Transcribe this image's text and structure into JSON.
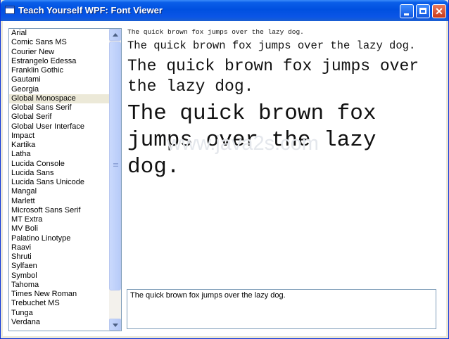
{
  "window": {
    "title": "Teach Yourself WPF: Font Viewer",
    "minimize_glyph": "",
    "maximize_glyph": "",
    "close_glyph": "✕"
  },
  "font_list": {
    "selected": "Global Monospace",
    "items": [
      "Arial",
      "Comic Sans MS",
      "Courier New",
      "Estrangelo Edessa",
      "Franklin Gothic",
      "Gautami",
      "Georgia",
      "Global Monospace",
      "Global Sans Serif",
      "Global Serif",
      "Global User Interface",
      "Impact",
      "Kartika",
      "Latha",
      "Lucida Console",
      "Lucida Sans",
      "Lucida Sans Unicode",
      "Mangal",
      "Marlett",
      "Microsoft Sans Serif",
      "MT Extra",
      "MV Boli",
      "Palatino Linotype",
      "Raavi",
      "Shruti",
      "Sylfaen",
      "Symbol",
      "Tahoma",
      "Times New Roman",
      "Trebuchet MS",
      "Tunga",
      "Verdana"
    ]
  },
  "preview": {
    "sample_1": "The quick brown fox jumps over the lazy dog.",
    "sample_2": "The quick brown fox jumps over the lazy dog.",
    "sample_3": "The quick brown fox jumps over the lazy dog.",
    "sample_4": "The quick brown fox jumps over the lazy dog.",
    "watermark": "www.java2s.com"
  },
  "sample_textbox": {
    "value": "The quick brown fox jumps over the lazy dog."
  },
  "colors": {
    "titlebar": "#0050e0",
    "selection": "#ece9d8",
    "border": "#7f9db9"
  }
}
